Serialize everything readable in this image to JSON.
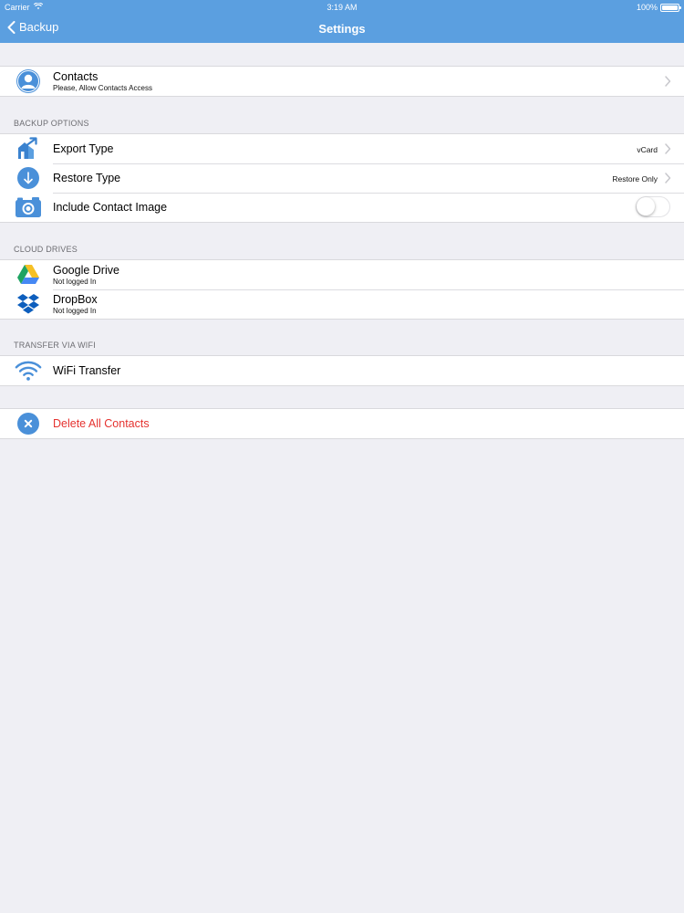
{
  "status_bar": {
    "carrier": "Carrier",
    "time": "3:19 AM",
    "battery": "100%"
  },
  "nav": {
    "back_label": "Backup",
    "title": "Settings"
  },
  "colors": {
    "accent": "#5b9fe0",
    "danger": "#e5322f",
    "background": "#efeff4"
  },
  "contacts_row": {
    "title": "Contacts",
    "subtitle": "Please, Allow Contacts Access",
    "icon": "person-icon"
  },
  "backup_options": {
    "header": "BACKUP OPTIONS",
    "export_type": {
      "title": "Export Type",
      "value": "vCard",
      "icon": "export-icon"
    },
    "restore_type": {
      "title": "Restore Type",
      "value": "Restore Only",
      "icon": "download-arrow-icon"
    },
    "include_image": {
      "title": "Include Contact Image",
      "toggle_on": false,
      "icon": "camera-icon"
    }
  },
  "cloud_drives": {
    "header": "CLOUD DRIVES",
    "google_drive": {
      "title": "Google Drive",
      "subtitle": "Not logged In",
      "icon": "google-drive-icon"
    },
    "dropbox": {
      "title": "DropBox",
      "subtitle": "Not logged In",
      "icon": "dropbox-icon"
    }
  },
  "transfer": {
    "header": "TRANSFER VIA WIFI",
    "wifi": {
      "title": "WiFi Transfer",
      "icon": "wifi-icon"
    }
  },
  "delete_row": {
    "title": "Delete All Contacts",
    "icon": "close-circle-icon"
  }
}
